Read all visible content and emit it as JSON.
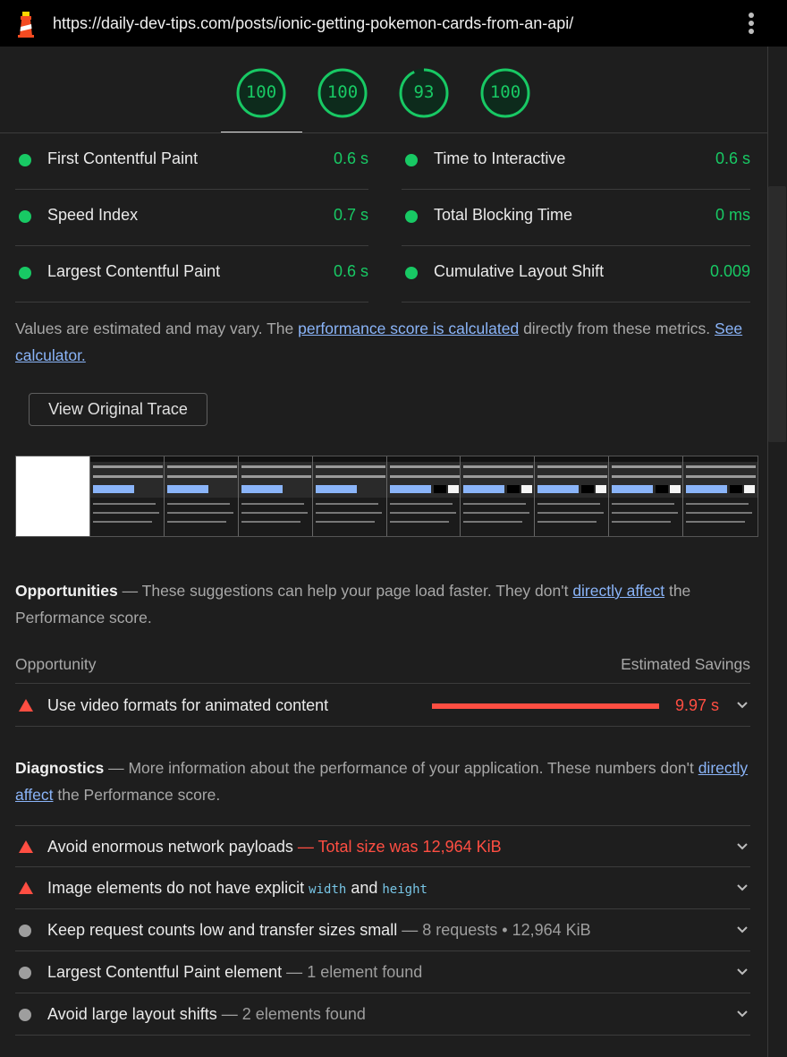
{
  "topbar": {
    "url": "https://daily-dev-tips.com/posts/ionic-getting-pokemon-cards-from-an-api/",
    "logo_icon": "lighthouse-icon",
    "menu_icon": "kebab-menu-icon"
  },
  "gauges": [
    {
      "score": "100",
      "fraction": 1.0
    },
    {
      "score": "100",
      "fraction": 1.0
    },
    {
      "score": "93",
      "fraction": 0.93
    },
    {
      "score": "100",
      "fraction": 1.0
    }
  ],
  "metrics": {
    "left": [
      {
        "name": "First Contentful Paint",
        "value": "0.6 s"
      },
      {
        "name": "Speed Index",
        "value": "0.7 s"
      },
      {
        "name": "Largest Contentful Paint",
        "value": "0.6 s"
      }
    ],
    "right": [
      {
        "name": "Time to Interactive",
        "value": "0.6 s"
      },
      {
        "name": "Total Blocking Time",
        "value": "0 ms"
      },
      {
        "name": "Cumulative Layout Shift",
        "value": "0.009"
      }
    ]
  },
  "note": {
    "before": "Values are estimated and may vary. The ",
    "link1": "performance score is calculated",
    "middle": " directly from these metrics. ",
    "link2": "See calculator."
  },
  "trace_button": "View Original Trace",
  "opportunities": {
    "title": "Opportunities",
    "dash": " — ",
    "desc_before": "These suggestions can help your page load faster. They don't ",
    "link": "directly affect",
    "desc_after": " the Performance score.",
    "col_left": "Opportunity",
    "col_right": "Estimated Savings",
    "items": [
      {
        "title": "Use video formats for animated content",
        "savings": "9.97 s"
      }
    ]
  },
  "diagnostics": {
    "title": "Diagnostics",
    "dash": " — ",
    "desc_before": "More information about the performance of your application. These numbers don't ",
    "link": "directly affect",
    "desc_after": " the Performance score.",
    "items": [
      {
        "title": "Avoid enormous network payloads",
        "sep": " — ",
        "detail": "Total size was 12,964 KiB"
      },
      {
        "title_a": "Image elements do not have explicit ",
        "code1": "width",
        "and": " and ",
        "code2": "height"
      },
      {
        "title": "Keep request counts low and transfer sizes small",
        "sep": " — ",
        "detail": "8 requests • 12,964 KiB"
      },
      {
        "title": "Largest Contentful Paint element",
        "sep": " — ",
        "detail": "1 element found"
      },
      {
        "title": "Avoid large layout shifts",
        "sep": " — ",
        "detail": "2 elements found"
      }
    ]
  },
  "colors": {
    "pass": "#18c964",
    "fail": "#ff4e42",
    "neutral": "#9e9e9e",
    "link": "#8ab4f8"
  }
}
